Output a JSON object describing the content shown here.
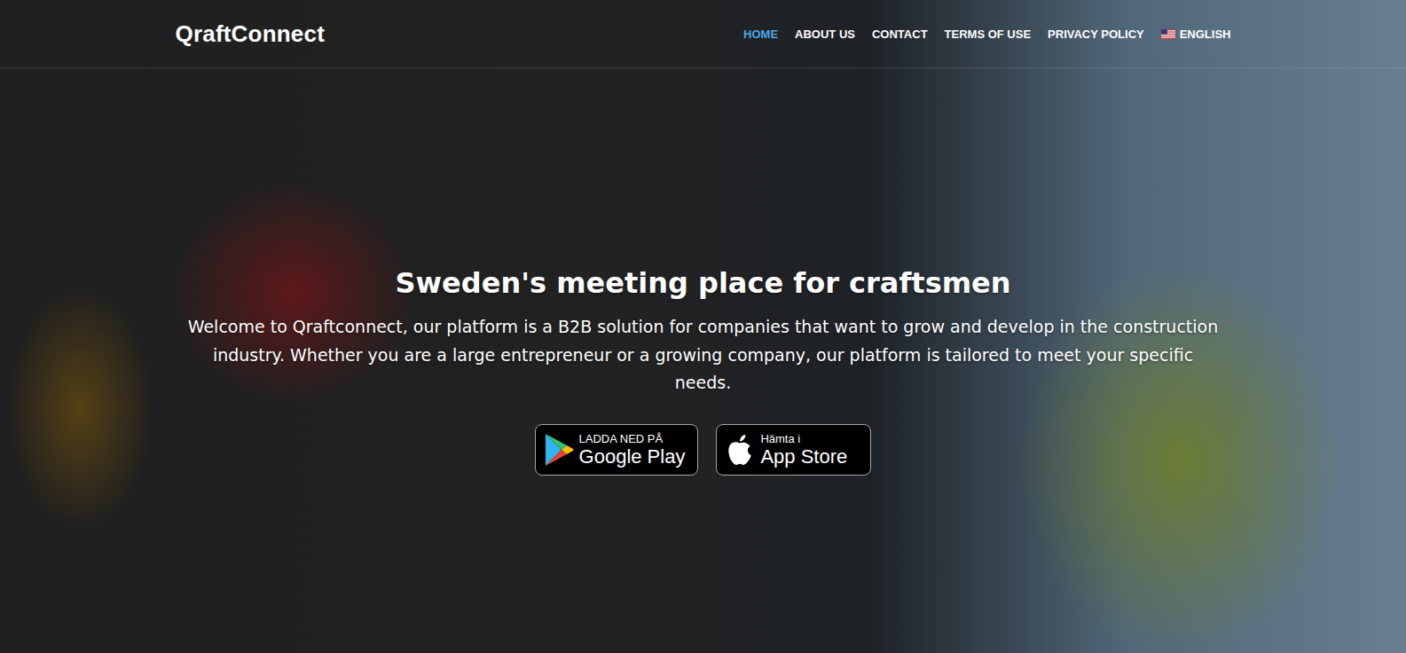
{
  "brand": {
    "name": "QraftConnect"
  },
  "nav": {
    "items": [
      {
        "label": "HOME",
        "selected": true
      },
      {
        "label": "ABOUT US",
        "selected": false
      },
      {
        "label": "CONTACT",
        "selected": false
      },
      {
        "label": "TERMS OF USE",
        "selected": false
      },
      {
        "label": "PRIVACY POLICY",
        "selected": false
      }
    ],
    "language": {
      "label": "ENGLISH"
    }
  },
  "hero": {
    "title": "Sweden's meeting place for craftsmen",
    "text": "Welcome to Qraftconnect, our platform is a B2B solution for companies that want to grow and develop in the construction industry. Whether you are a large entrepreneur or a growing company, our platform is tailored to meet your specific needs."
  },
  "store_buttons": [
    {
      "kind": "google-play",
      "caption": "LADDA NED PÅ",
      "name": "Google Play"
    },
    {
      "kind": "app-store",
      "caption": "Hämta i",
      "name": "App Store"
    }
  ]
}
